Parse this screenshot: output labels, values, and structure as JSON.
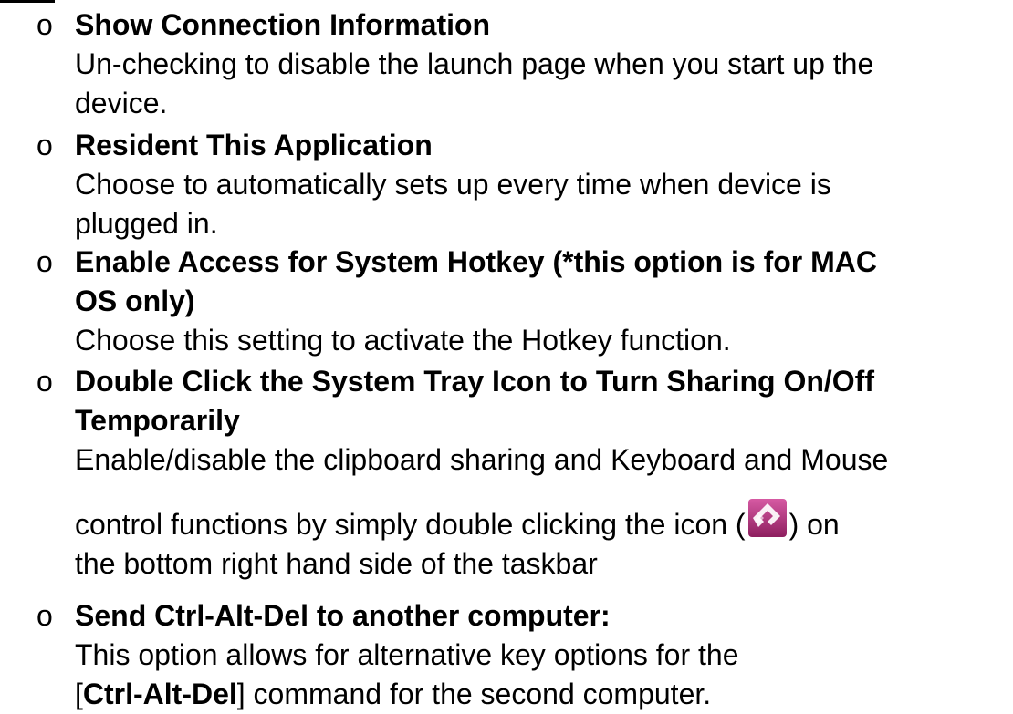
{
  "bullet_symbol": "o",
  "items": [
    {
      "heading": "Show Connection Information",
      "desc_line1": "Un-checking to disable the launch page when you start up the",
      "desc_line2": "device."
    },
    {
      "heading": "Resident This Application",
      "desc_line1": "Choose to automatically sets up every time when device is",
      "desc_line2": "plugged in."
    },
    {
      "heading_line1": "Enable Access for System Hotkey (*this option is for MAC",
      "heading_line2": "OS only)",
      "desc_line1": "Choose this setting to activate the Hotkey function."
    },
    {
      "heading_line1": "Double Click the System Tray Icon to Turn Sharing On/Off",
      "heading_line2": "Temporarily",
      "desc_line1": "Enable/disable the clipboard sharing and Keyboard and Mouse",
      "desc_line2_before_icon": "control functions by simply double clicking the icon (",
      "desc_line2_after_icon": ") on",
      "desc_line3": "the bottom right hand side of the taskbar",
      "icon": "sharing-app-icon",
      "icon_color": "#b0307a"
    },
    {
      "heading": "Send Ctrl-Alt-Del to another computer:",
      "desc_line1": "This option allows for alternative key options for the",
      "desc_line2_open": "[",
      "desc_line2_bold": "Ctrl-Alt-Del",
      "desc_line2_rest": "] command for the second computer."
    }
  ]
}
